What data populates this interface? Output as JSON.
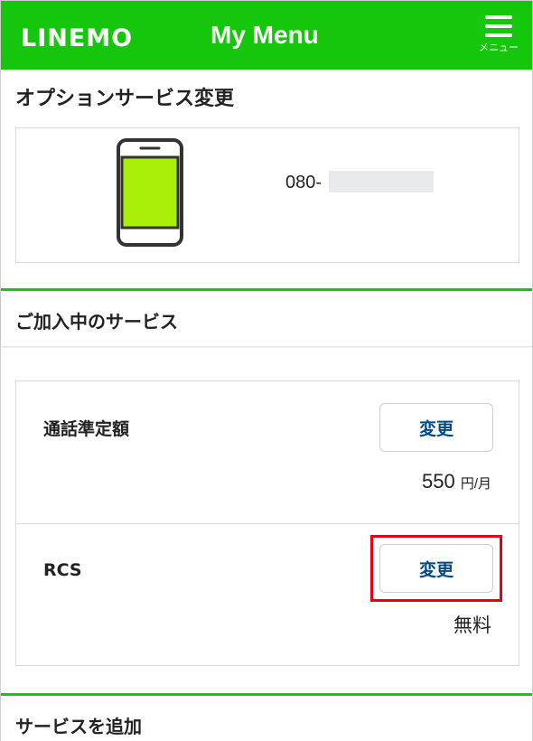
{
  "header": {
    "logo": "LINEMO",
    "title": "My Menu",
    "menu_label": "メニュー"
  },
  "page": {
    "title": "オプションサービス変更"
  },
  "line": {
    "number_prefix": "080-"
  },
  "subscribed": {
    "section_title": "ご加入中のサービス",
    "services": [
      {
        "name": "通話準定額",
        "button": "変更",
        "price": "550",
        "unit": "円/月"
      },
      {
        "name": "RCS",
        "button": "変更",
        "price": "無料"
      }
    ]
  },
  "add_services": {
    "section_title": "サービスを追加"
  },
  "colors": {
    "brand_green": "#16c60c",
    "phone_screen": "#a8f00a",
    "button_text": "#004a85",
    "highlight_red": "#e60012"
  }
}
